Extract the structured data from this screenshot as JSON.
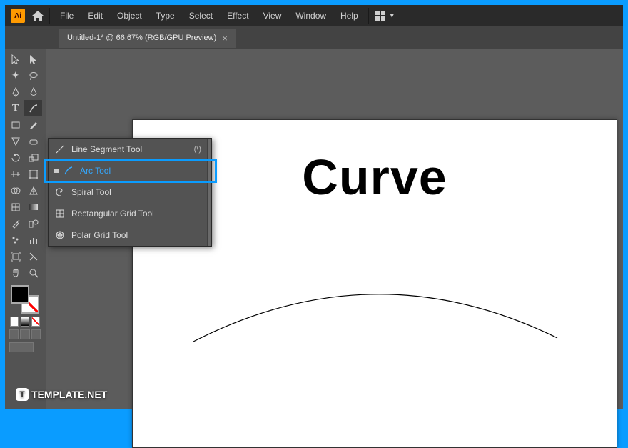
{
  "app_badge": "Ai",
  "menus": [
    "File",
    "Edit",
    "Object",
    "Type",
    "Select",
    "Effect",
    "View",
    "Window",
    "Help"
  ],
  "tab": {
    "label": "Untitled-1* @ 66.67% (RGB/GPU Preview)"
  },
  "flyout": {
    "items": [
      {
        "icon": "line",
        "label": "Line Segment Tool",
        "shortcut": "(\\)",
        "selected": false
      },
      {
        "icon": "arc",
        "label": "Arc Tool",
        "shortcut": "",
        "selected": true
      },
      {
        "icon": "spiral",
        "label": "Spiral Tool",
        "shortcut": "",
        "selected": false
      },
      {
        "icon": "rect-grid",
        "label": "Rectangular Grid Tool",
        "shortcut": "",
        "selected": false
      },
      {
        "icon": "polar-grid",
        "label": "Polar Grid Tool",
        "shortcut": "",
        "selected": false
      }
    ]
  },
  "canvas": {
    "headline": "Curve"
  },
  "watermark": {
    "badge": "T",
    "text": "TEMPLATE.NET"
  }
}
